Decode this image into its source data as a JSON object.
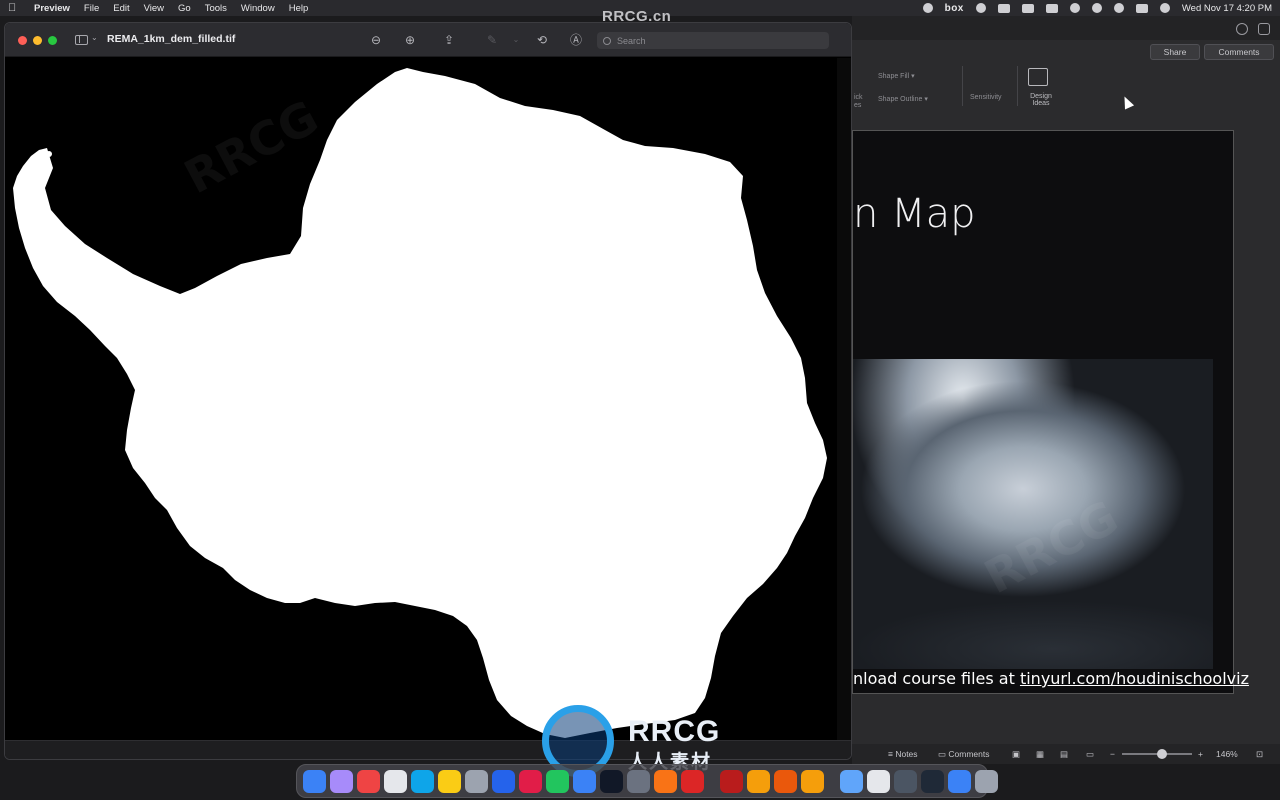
{
  "menubar": {
    "app_name": "Preview",
    "items": [
      "File",
      "Edit",
      "View",
      "Go",
      "Tools",
      "Window",
      "Help"
    ],
    "status_box": "box",
    "clock": "Wed Nov 17  4:20 PM"
  },
  "watermark_top": "RRCG.cn",
  "preview": {
    "filename": "REMA_1km_dem_filled.tif",
    "search_placeholder": "Search"
  },
  "powerpoint": {
    "share_label": "Share",
    "comments_label": "Comments",
    "ribbon": {
      "shape_fill": "Shape Fill",
      "shape_outline": "Shape Outline",
      "sensitivity": "Sensitivity",
      "design_ideas": "Design Ideas",
      "partial_quick": "ick",
      "partial_styles": "es"
    },
    "slide": {
      "title_fragment": "n Map",
      "caption_prefix": "nload course files at ",
      "caption_link": "tinyurl.com/houdinischoolviz"
    },
    "statusbar": {
      "notes": "Notes",
      "comments": "Comments",
      "zoom": "146%",
      "zoom_minus": "−",
      "zoom_plus": "+"
    }
  },
  "logo": {
    "text_top": "RRCG",
    "text_bottom": "人人素材"
  },
  "dock_colors": [
    "#3b82f6",
    "#a78bfa",
    "#ef4444",
    "#e5e7eb",
    "#0ea5e9",
    "#facc15",
    "#9ca3af",
    "#2563eb",
    "#e11d48",
    "#22c55e",
    "#3b82f6",
    "#111827",
    "#6b7280",
    "#f97316",
    "#dc2626",
    "#b91c1c",
    "#f59e0b",
    "#ea580c",
    "#f59e0b",
    "#60a5fa",
    "#e5e7eb",
    "#4b5563",
    "#1f2937",
    "#3b82f6",
    "#9ca3af"
  ]
}
